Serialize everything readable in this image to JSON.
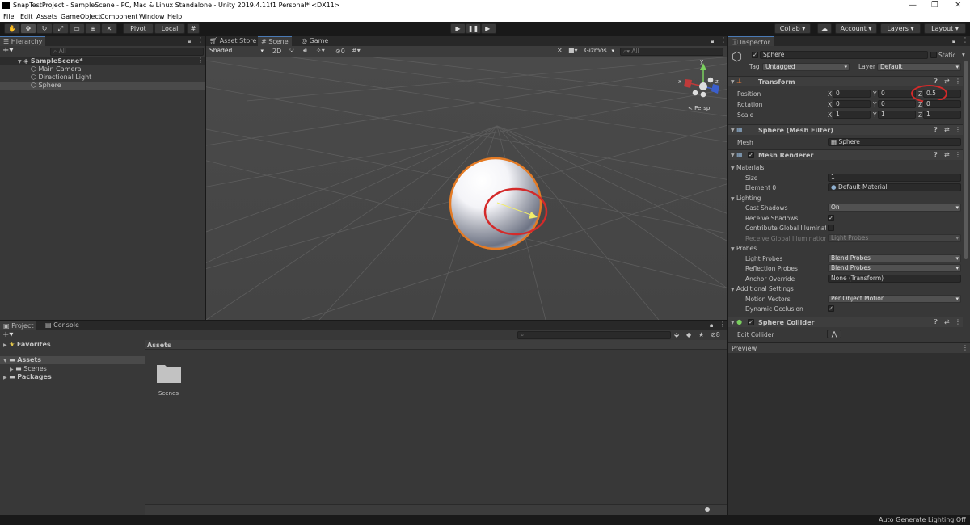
{
  "window": {
    "title": "SnapTestProject - SampleScene - PC, Mac & Linux Standalone - Unity 2019.4.11f1 Personal* <DX11>"
  },
  "menu": [
    "File",
    "Edit",
    "Assets",
    "GameObject",
    "Component",
    "Window",
    "Help"
  ],
  "toolbar": {
    "pivot": "Pivot",
    "local": "Local",
    "collab": "Collab",
    "account": "Account",
    "layers": "Layers",
    "layout": "Layout"
  },
  "hierarchy": {
    "tab": "Hierarchy",
    "search_placeholder": "All",
    "scene": "SampleScene*",
    "items": [
      "Main Camera",
      "Directional Light",
      "Sphere"
    ]
  },
  "scene_view": {
    "tabs": [
      "Asset Store",
      "Scene",
      "Game"
    ],
    "shading": "Shaded",
    "mode_2d": "2D",
    "fx_count": "0",
    "gizmos": "Gizmos",
    "search_placeholder": "All",
    "persp": "< Persp",
    "axis_y": "y",
    "axis_x": "x",
    "axis_z": "z"
  },
  "project": {
    "tabs": [
      "Project",
      "Console"
    ],
    "favorites": "Favorites",
    "assets": "Assets",
    "scenes": "Scenes",
    "packages": "Packages",
    "breadcrumb": "Assets",
    "folder_label": "Scenes",
    "hidden_count": "8"
  },
  "inspector": {
    "tab": "Inspector",
    "object_name": "Sphere",
    "static": "Static",
    "tag_label": "Tag",
    "tag_value": "Untagged",
    "layer_label": "Layer",
    "layer_value": "Default",
    "transform": {
      "title": "Transform",
      "position": "Position",
      "rotation": "Rotation",
      "scale": "Scale",
      "pos": [
        "0",
        "0",
        "0.5"
      ],
      "rot": [
        "0",
        "0",
        "0"
      ],
      "scl": [
        "1",
        "1",
        "1"
      ]
    },
    "mesh_filter": {
      "title": "Sphere (Mesh Filter)",
      "mesh_label": "Mesh",
      "mesh_value": "Sphere"
    },
    "mesh_renderer": {
      "title": "Mesh Renderer",
      "materials": "Materials",
      "size_label": "Size",
      "size_value": "1",
      "element0_label": "Element 0",
      "element0_value": "Default-Material",
      "lighting": "Lighting",
      "cast_shadows": "Cast Shadows",
      "cast_shadows_value": "On",
      "receive_shadows": "Receive Shadows",
      "contribute_gi": "Contribute Global Illumination",
      "receive_gi": "Receive Global Illumination",
      "receive_gi_value": "Light Probes",
      "probes": "Probes",
      "light_probes": "Light Probes",
      "light_probes_value": "Blend Probes",
      "reflection_probes": "Reflection Probes",
      "reflection_probes_value": "Blend Probes",
      "anchor_override": "Anchor Override",
      "anchor_override_value": "None (Transform)",
      "additional": "Additional Settings",
      "motion_vectors": "Motion Vectors",
      "motion_vectors_value": "Per Object Motion",
      "dynamic_occlusion": "Dynamic Occlusion"
    },
    "sphere_collider": {
      "title": "Sphere Collider",
      "edit_collider": "Edit Collider"
    },
    "preview": "Preview"
  },
  "status": {
    "text": "Auto Generate Lighting Off"
  },
  "axis_labels": {
    "x": "X",
    "y": "Y",
    "z": "Z"
  }
}
